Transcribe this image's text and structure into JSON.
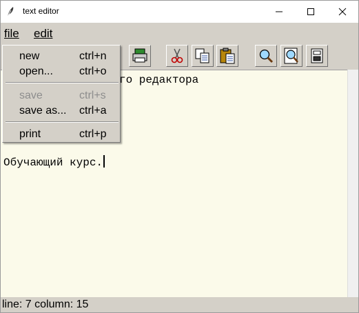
{
  "window": {
    "title": "text editor"
  },
  "menubar": {
    "file": "file",
    "edit": "edit"
  },
  "toolbar": {
    "buttons": [
      "print-icon",
      "cut-icon",
      "copy-icon",
      "paste-icon",
      "find-icon",
      "zoom-icon",
      "save-as-icon"
    ]
  },
  "file_menu": {
    "items": [
      {
        "label": "new",
        "accel": "ctrl+n",
        "enabled": true
      },
      {
        "label": "open...",
        "accel": "ctrl+o",
        "enabled": true
      },
      {
        "label": "save",
        "accel": "ctrl+s",
        "enabled": false
      },
      {
        "label": "save as...",
        "accel": "ctrl+a",
        "enabled": true
      },
      {
        "label": "print",
        "accel": "ctrl+p",
        "enabled": true
      }
    ]
  },
  "editor": {
    "lines": [
      "го редактора",
      "Обучающий курс."
    ],
    "background": "#fbfaea"
  },
  "status": {
    "text": "line: 7 column: 15"
  }
}
